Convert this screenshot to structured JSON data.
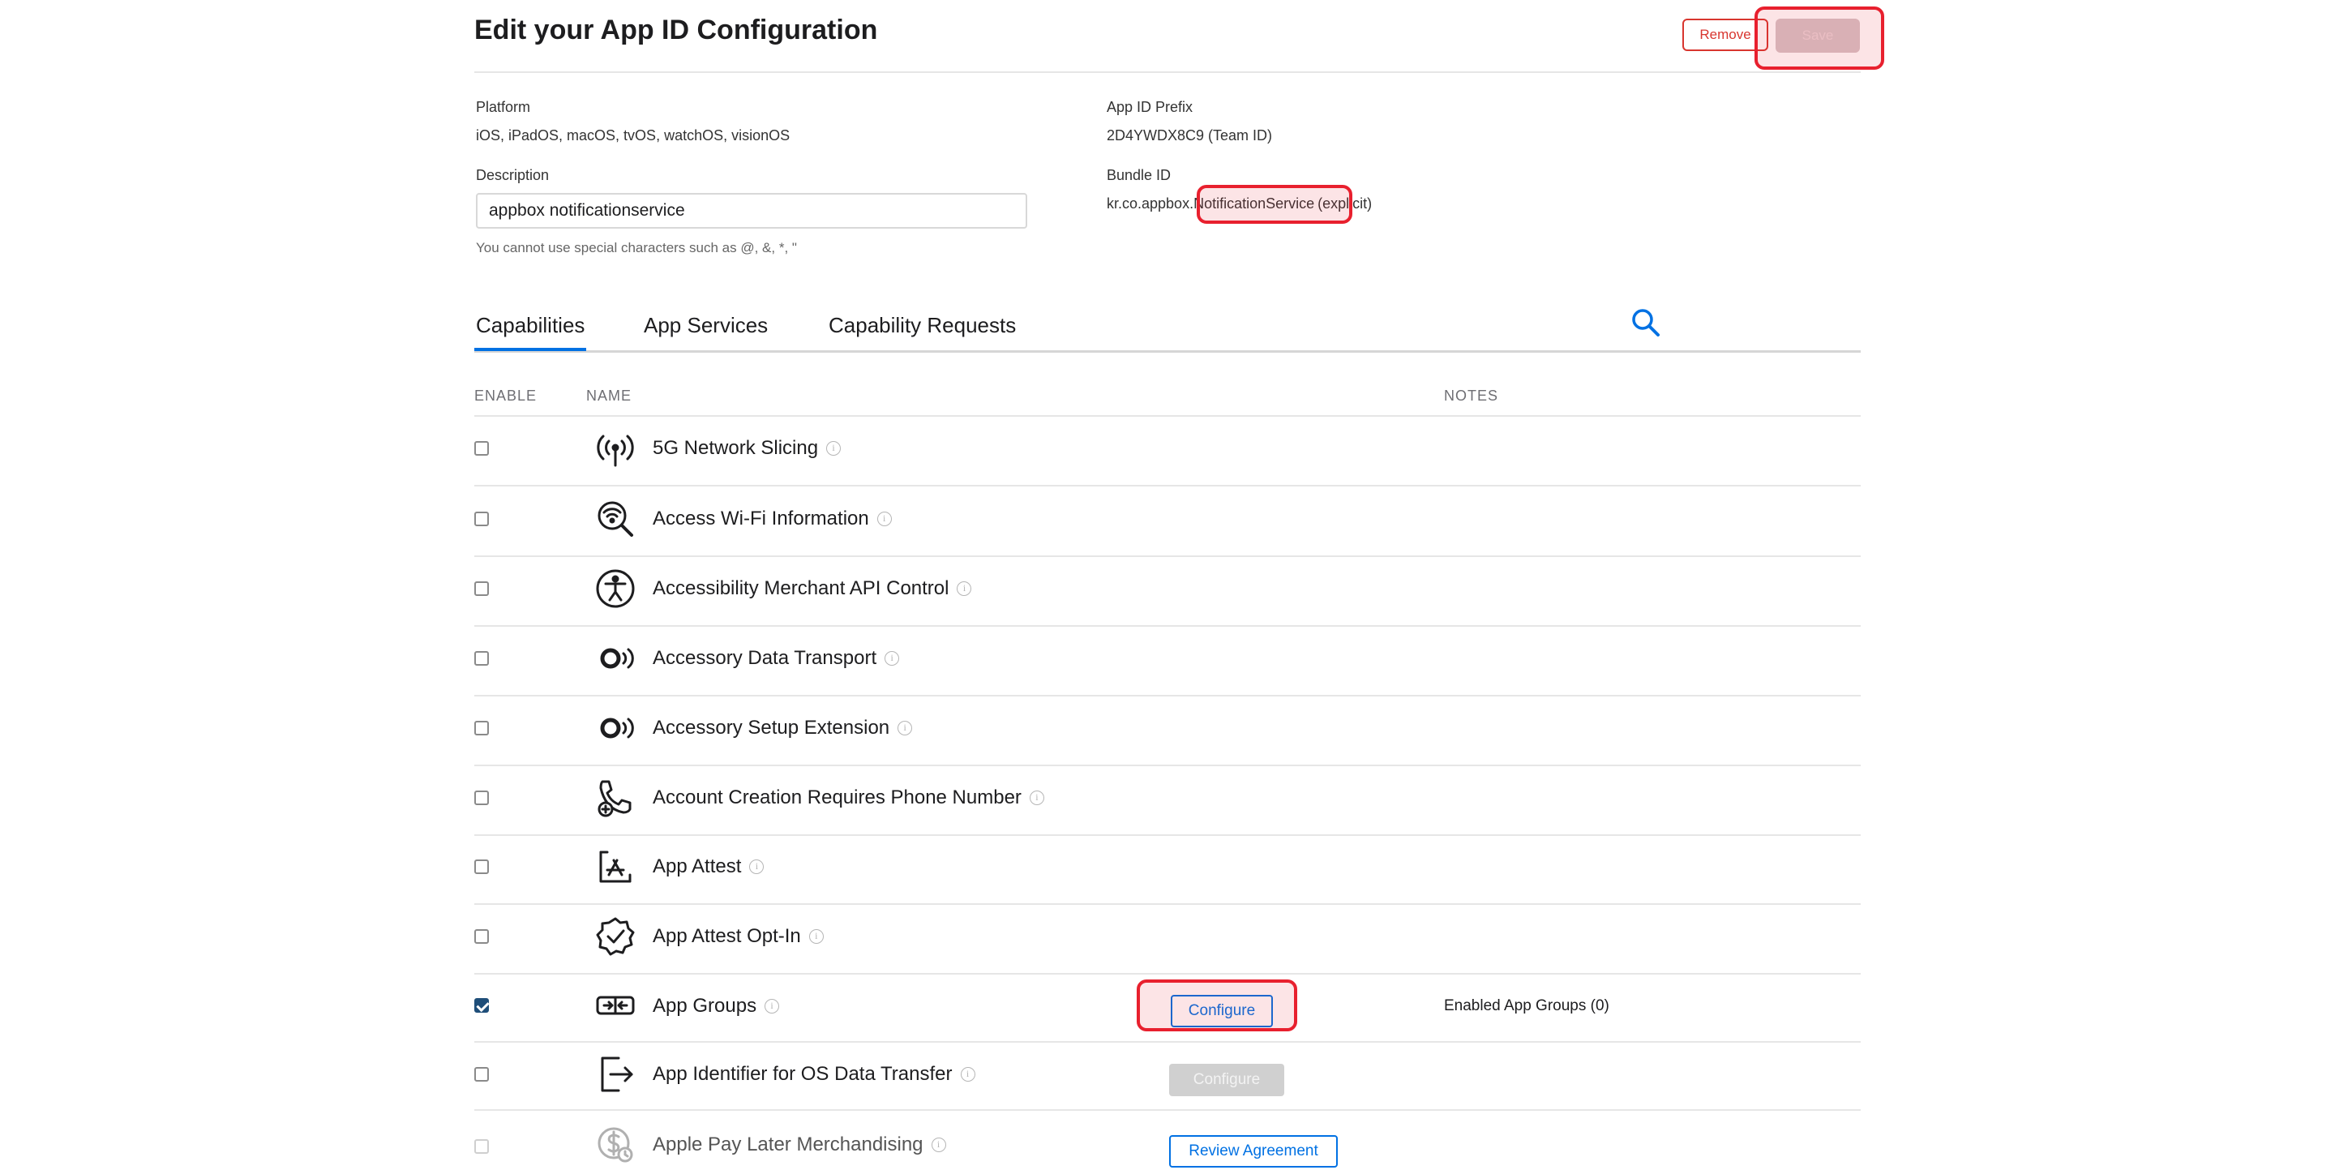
{
  "page": {
    "title": "Edit your App ID Configuration",
    "remove_label": "Remove",
    "save_label": "Save"
  },
  "platform": {
    "label": "Platform",
    "value": "iOS, iPadOS, macOS, tvOS, watchOS, visionOS"
  },
  "prefix": {
    "label": "App ID Prefix",
    "value": "2D4YWDX8C9 (Team ID)"
  },
  "description": {
    "label": "Description",
    "value": "appbox notificationservice",
    "hint": "You cannot use special characters such as @, &, *, \""
  },
  "bundle": {
    "label": "Bundle ID",
    "prefix": "kr.co.appbox.",
    "highlight": "NotificationService",
    "suffix": "(explicit)"
  },
  "tabs": [
    {
      "label": "Capabilities",
      "active": true
    },
    {
      "label": "App Services"
    },
    {
      "label": "Capability Requests"
    }
  ],
  "table": {
    "headers": {
      "enable": "ENABLE",
      "name": "NAME",
      "notes": "NOTES"
    },
    "rows": [
      {
        "name": "5G Network Slicing",
        "icon": "antenna-icon",
        "checked": false
      },
      {
        "name": "Access Wi-Fi Information",
        "icon": "wifi-search-icon",
        "checked": false
      },
      {
        "name": "Accessibility Merchant API Control",
        "icon": "accessibility-icon",
        "checked": false
      },
      {
        "name": "Accessory Data Transport",
        "icon": "accessory-icon",
        "checked": false
      },
      {
        "name": "Accessory Setup Extension",
        "icon": "accessory-icon",
        "checked": false
      },
      {
        "name": "Account Creation Requires Phone Number",
        "icon": "phone-plus-icon",
        "checked": false
      },
      {
        "name": "App Attest",
        "icon": "app-store-icon",
        "checked": false
      },
      {
        "name": "App Attest Opt-In",
        "icon": "verified-badge-icon",
        "checked": false
      },
      {
        "name": "App Groups",
        "icon": "app-groups-icon",
        "checked": true,
        "action": "Configure",
        "notes": "Enabled App Groups (0)"
      },
      {
        "name": "App Identifier for OS Data Transfer",
        "icon": "export-icon",
        "checked": false,
        "action": "Configure",
        "action_disabled": true
      },
      {
        "name": "Apple Pay Later Merchandising",
        "icon": "apple-pay-later-icon",
        "checked": false,
        "disabled": true,
        "action": "Review Agreement"
      }
    ]
  },
  "colors": {
    "accent": "#0071e3",
    "danger": "#d8362f",
    "highlight": "#e8202e"
  }
}
